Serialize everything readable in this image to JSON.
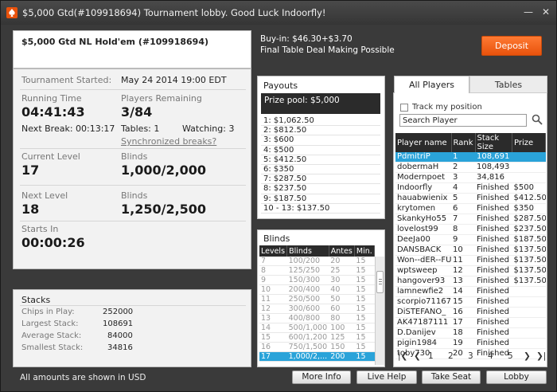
{
  "window": {
    "title": "$5,000 Gtd(#109918694) Tournament lobby. Good Luck Indoorfly!",
    "icon": "spade-logo-icon"
  },
  "header": {
    "tournament_name": "$5,000 Gtd NL Hold'em (#109918694)",
    "buyin": "Buy-in: $46.30+$3.70",
    "deal_note": "Final Table Deal Making Possible",
    "deposit_label": "Deposit"
  },
  "info": {
    "started_label": "Tournament Started:",
    "started_value": "May 24 2014   19:00 EDT",
    "running_label": "Running Time",
    "running_value": "04:41:43",
    "remaining_label": "Players Remaining",
    "remaining_value": "3/84",
    "next_break": "Next Break: 00:13:17",
    "tables": "Tables: 1",
    "watching": "Watching: 3",
    "sync_link": "Synchronized breaks?",
    "current_level_label": "Current Level",
    "current_level_value": "17",
    "blinds_label": "Blinds",
    "current_blinds_value": "1,000/2,000",
    "next_level_label": "Next Level",
    "next_level_value": "18",
    "next_blinds_value": "1,250/2,500",
    "starts_in_label": "Starts In",
    "starts_in_value": "00:00:26"
  },
  "stacks": {
    "title": "Stacks",
    "chips_label": "Chips in Play:",
    "chips_value": "252000",
    "largest_label": "Largest Stack:",
    "largest_value": "108691",
    "average_label": "Average Stack:",
    "average_value": "84000",
    "smallest_label": "Smallest Stack:",
    "smallest_value": "34816"
  },
  "payouts": {
    "title": "Payouts",
    "prize_pool": "Prize pool: $5,000",
    "rows": [
      "1: $1,062.50",
      "2: $812.50",
      "3: $600",
      "4: $500",
      "5: $412.50",
      "6: $350",
      "7: $287.50",
      "8: $237.50",
      "9: $187.50",
      "10 - 13: $137.50"
    ]
  },
  "blinds": {
    "title": "Blinds",
    "headers": [
      "Levels",
      "Blinds",
      "Antes",
      "Min."
    ],
    "rows": [
      [
        "7",
        "100/200",
        "20",
        "15"
      ],
      [
        "8",
        "125/250",
        "25",
        "15"
      ],
      [
        "9",
        "150/300",
        "30",
        "15"
      ],
      [
        "10",
        "200/400",
        "40",
        "15"
      ],
      [
        "11",
        "250/500",
        "50",
        "15"
      ],
      [
        "12",
        "300/600",
        "60",
        "15"
      ],
      [
        "13",
        "400/800",
        "80",
        "15"
      ],
      [
        "14",
        "500/1,000",
        "100",
        "15"
      ],
      [
        "15",
        "600/1,200",
        "125",
        "15"
      ],
      [
        "16",
        "750/1,500",
        "150",
        "15"
      ],
      [
        "17",
        "1,000/2,...",
        "200",
        "15"
      ]
    ],
    "selected_index": 10
  },
  "players": {
    "tab_all": "All Players",
    "tab_tables": "Tables",
    "track_label": "Track my position",
    "search_value": "Search Player",
    "headers": [
      "Player name",
      "Rank",
      "Stack Size",
      "Prize"
    ],
    "rows": [
      [
        "PdmitriP",
        "1",
        "108,691",
        ""
      ],
      [
        "dobermaH",
        "2",
        "108,493",
        ""
      ],
      [
        "Modernpoet",
        "3",
        "34,816",
        ""
      ],
      [
        "Indoorfly",
        "4",
        "Finished",
        "$500"
      ],
      [
        "hauabwienix",
        "5",
        "Finished",
        "$412.50"
      ],
      [
        "krytomen",
        "6",
        "Finished",
        "$350"
      ],
      [
        "SkankyHo55",
        "7",
        "Finished",
        "$287.50"
      ],
      [
        "lovelost99",
        "8",
        "Finished",
        "$237.50"
      ],
      [
        "DeeJa00",
        "9",
        "Finished",
        "$187.50"
      ],
      [
        "DANSBACK",
        "10",
        "Finished",
        "$137.50"
      ],
      [
        "Won--dER--FULI",
        "11",
        "Finished",
        "$137.50"
      ],
      [
        "wptsweep",
        "12",
        "Finished",
        "$137.50"
      ],
      [
        "hangover93",
        "13",
        "Finished",
        "$137.50"
      ],
      [
        "lamnewfie2",
        "14",
        "Finished",
        ""
      ],
      [
        "scorpio71167",
        "15",
        "Finished",
        ""
      ],
      [
        "DiSTEFANO_",
        "16",
        "Finished",
        ""
      ],
      [
        "AK47187111",
        "17",
        "Finished",
        ""
      ],
      [
        "D.Danijev",
        "18",
        "Finished",
        ""
      ],
      [
        "pigin1984",
        "19",
        "Finished",
        ""
      ],
      [
        "toby730",
        "20",
        "Finished",
        ""
      ]
    ],
    "selected_index": 0,
    "pages": [
      "1",
      "2",
      "3",
      "4",
      "5"
    ]
  },
  "footer": {
    "note": "All amounts are shown in USD",
    "more_info": "More Info",
    "live_help": "Live Help",
    "take_seat": "Take Seat",
    "lobby": "Lobby"
  },
  "colors": {
    "accent": "#2aa3d9",
    "deposit": "#f0631a"
  }
}
